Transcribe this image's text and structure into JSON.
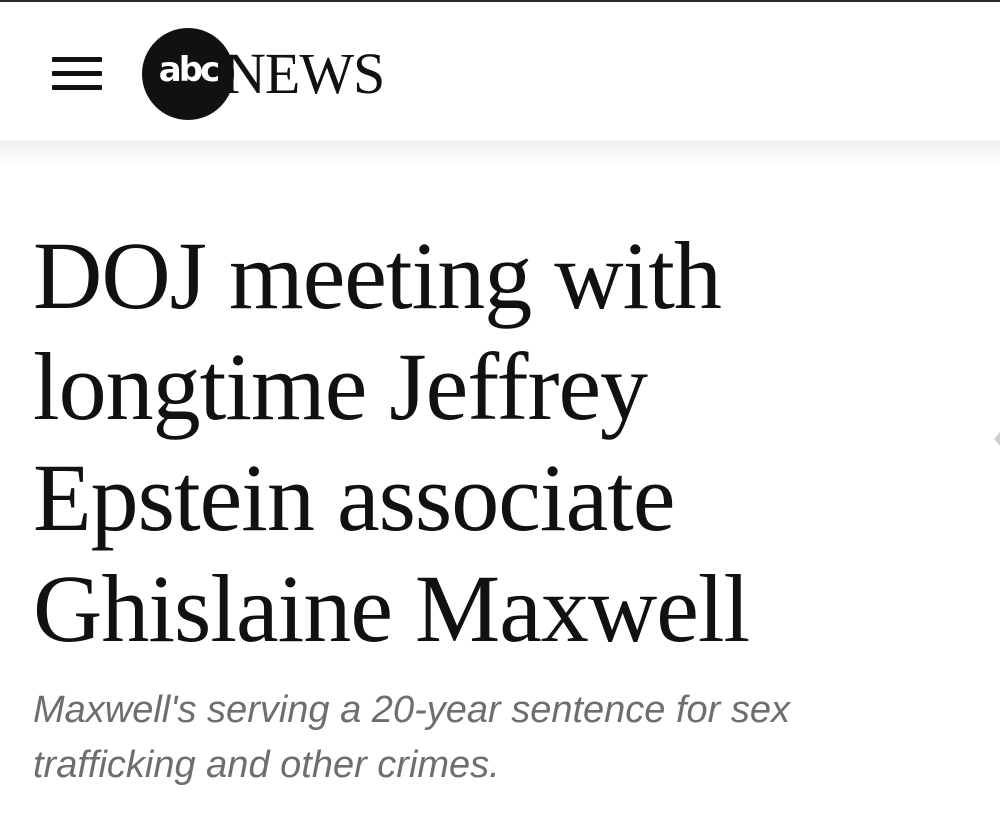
{
  "header": {
    "menu_icon": "hamburger-menu-icon",
    "logo": {
      "abc": "abc",
      "news": "NEWS"
    }
  },
  "article": {
    "headline": "DOJ meeting with longtime Jeffrey Epstein associate Ghislaine Maxwell",
    "subheadline": "Maxwell's serving a 20-year sentence for sex trafficking and other crimes."
  },
  "colors": {
    "text": "#111111",
    "subtext": "#6e6e6e",
    "background": "#ffffff"
  }
}
